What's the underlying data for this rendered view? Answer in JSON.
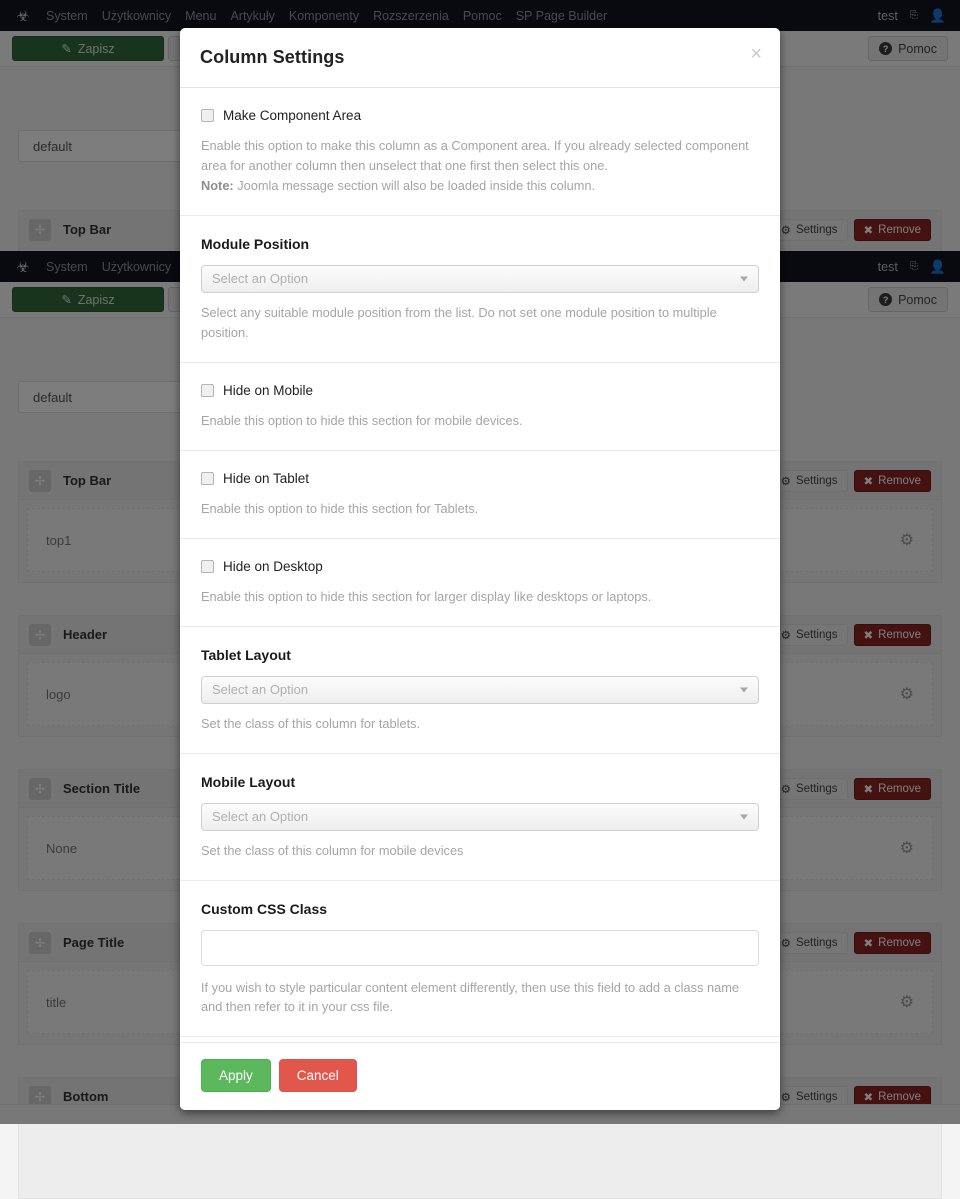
{
  "admin_bar": {
    "logo_icon": "joomla-logo-icon",
    "items": [
      "System",
      "Użytkownicy",
      "Menu",
      "Artykuły",
      "Komponenty",
      "Rozszerzenia",
      "Pomoc",
      "SP Page Builder"
    ],
    "site_name": "test",
    "external_icon": "external-link-icon",
    "user_icon": "user-icon"
  },
  "toolbar": {
    "save_label": "Zapisz",
    "save_icon": "pencil-square-icon",
    "dropdown_icon": "caret-down-icon",
    "help_label": "Pomoc",
    "help_icon": "question-circle-icon"
  },
  "builder": {
    "template_field_value": "default",
    "settings_label": "Settings",
    "settings_icon": "gears-icon",
    "remove_label": "Remove",
    "remove_icon": "times-icon",
    "move_icon": "arrows-move-icon",
    "column_gear_icon": "gears-icon",
    "rows": [
      {
        "title": "Top Bar",
        "column_value": "top1"
      },
      {
        "title": "Header",
        "column_value": "logo"
      },
      {
        "title": "Section Title",
        "column_value": "None"
      },
      {
        "title": "Page Title",
        "column_value": "title"
      },
      {
        "title": "Bottom",
        "column_value": ""
      }
    ]
  },
  "modal": {
    "title": "Column Settings",
    "close_icon": "close-icon",
    "sections": {
      "component_area": {
        "checkbox_label": "Make Component Area",
        "help_line1": "Enable this option to make this column as a Component area. If you already selected component area for another column then unselect that one first then select this one.",
        "help_note_label": "Note:",
        "help_note_text": " Joomla message section will also be loaded inside this column."
      },
      "module_position": {
        "label": "Module Position",
        "select_value": "Select an Option",
        "caret_icon": "caret-down-icon",
        "help": "Select any suitable module position from the list. Do not set one module position to multiple position."
      },
      "hide_mobile": {
        "checkbox_label": "Hide on Mobile",
        "help": "Enable this option to hide this section for mobile devices."
      },
      "hide_tablet": {
        "checkbox_label": "Hide on Tablet",
        "help": "Enable this option to hide this section for Tablets."
      },
      "hide_desktop": {
        "checkbox_label": "Hide on Desktop",
        "help": "Enable this option to hide this section for larger display like desktops or laptops."
      },
      "tablet_layout": {
        "label": "Tablet Layout",
        "select_value": "Select an Option",
        "caret_icon": "caret-down-icon",
        "help": "Set the class of this column for tablets."
      },
      "mobile_layout": {
        "label": "Mobile Layout",
        "select_value": "Select an Option",
        "caret_icon": "caret-down-icon",
        "help": "Set the class of this column for mobile devices"
      },
      "custom_css": {
        "label": "Custom CSS Class",
        "input_value": "",
        "input_placeholder": "",
        "help": "If you wish to style particular content element differently, then use this field to add a class name and then refer to it in your css file."
      }
    },
    "footer": {
      "apply_label": "Apply",
      "cancel_label": "Cancel"
    }
  },
  "colors": {
    "apply_green": "#5cb85c",
    "cancel_red": "#e2574c",
    "admin_bar_dark": "#101420",
    "save_green": "#30683a",
    "remove_red": "#8a2222"
  }
}
